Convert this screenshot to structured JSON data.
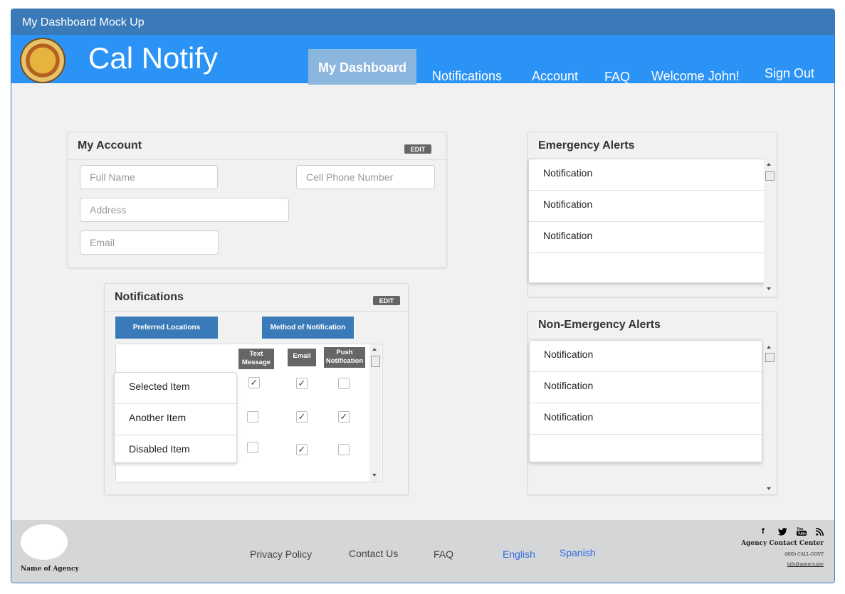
{
  "window": {
    "title": "My Dashboard Mock Up"
  },
  "header": {
    "brand": "Cal Notify",
    "nav": {
      "dashboard": "My Dashboard",
      "notifications": "Notifications",
      "account": "Account",
      "faq": "FAQ",
      "welcome": "Welcome John!",
      "signout": "Sign Out"
    }
  },
  "account": {
    "title": "My Account",
    "edit": "EDIT",
    "full_name_ph": "Full Name",
    "cell_ph": "Cell Phone Number",
    "address_ph": "Address",
    "email_ph": "Email"
  },
  "notifications": {
    "title": "Notifications",
    "edit": "EDIT",
    "preferred_locations": "Preferred Locations",
    "method": "Method of Notification",
    "columns": [
      "Text Message",
      "Email",
      "Push Notification"
    ],
    "items": [
      {
        "label": "Selected Item",
        "checks": [
          true,
          true,
          false
        ]
      },
      {
        "label": "Another Item",
        "checks": [
          false,
          true,
          true
        ]
      },
      {
        "label": "Disabled Item",
        "checks": [
          false,
          true,
          false
        ]
      }
    ]
  },
  "emergency": {
    "title": "Emergency Alerts",
    "items": [
      "Notification",
      "Notification",
      "Notification",
      ""
    ]
  },
  "non_emergency": {
    "title": "Non-Emergency Alerts",
    "items": [
      "Notification",
      "Notification",
      "Notification",
      ""
    ]
  },
  "footer": {
    "agency": "Name of Agency",
    "links": {
      "privacy": "Privacy Policy",
      "contact": "Contact Us",
      "faq": "FAQ"
    },
    "langs": {
      "english": "English",
      "spanish": "Spanish"
    },
    "contact_center": "Agency Contact Center",
    "phone": "(800) CALL-GOVT",
    "email": "info@agency.gov",
    "social_icons": [
      "facebook-icon",
      "twitter-icon",
      "youtube-icon",
      "rss-icon"
    ]
  }
}
